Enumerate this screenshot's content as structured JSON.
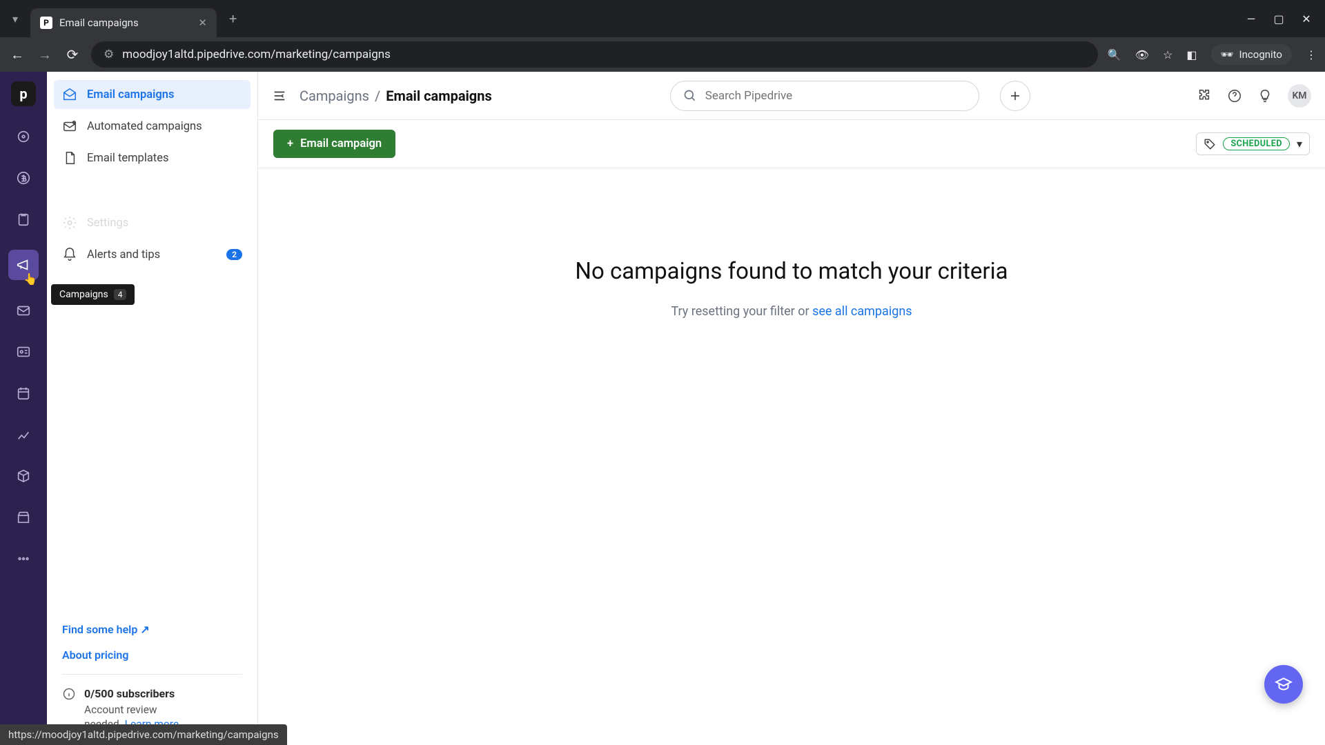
{
  "browser": {
    "tab_title": "Email campaigns",
    "tab_favicon": "P",
    "url_display": "moodjoy1altd.pipedrive.com/marketing/campaigns",
    "incognito_label": "Incognito",
    "status_url": "https://moodjoy1altd.pipedrive.com/marketing/campaigns"
  },
  "rail_tooltip": {
    "label": "Campaigns",
    "count": "4"
  },
  "breadcrumb": {
    "parent": "Campaigns",
    "sep": "/",
    "current": "Email campaigns"
  },
  "search": {
    "placeholder": "Search Pipedrive"
  },
  "avatar_initials": "KM",
  "sidebar": {
    "items": [
      {
        "label": "Email campaigns",
        "active": true,
        "icon": "envelope-open"
      },
      {
        "label": "Automated campaigns",
        "active": false,
        "icon": "envelope-auto"
      },
      {
        "label": "Email templates",
        "active": false,
        "icon": "file"
      }
    ],
    "secondary": [
      {
        "label": "Settings",
        "icon": "gear",
        "badge": null,
        "obscured": true
      },
      {
        "label": "Alerts and tips",
        "icon": "bell",
        "badge": "2"
      }
    ],
    "help_label": "Find some help",
    "about_label": "About pricing",
    "info": {
      "title": "0/500 subscribers",
      "desc_line1": "Account review",
      "desc_line2": "needed.",
      "learn_label": "Learn more"
    }
  },
  "actionbar": {
    "create_label": "Email campaign",
    "filter_label": "SCHEDULED"
  },
  "empty": {
    "title": "No campaigns found to match your criteria",
    "sub_prefix": "Try resetting your filter or ",
    "sub_link": "see all campaigns"
  }
}
